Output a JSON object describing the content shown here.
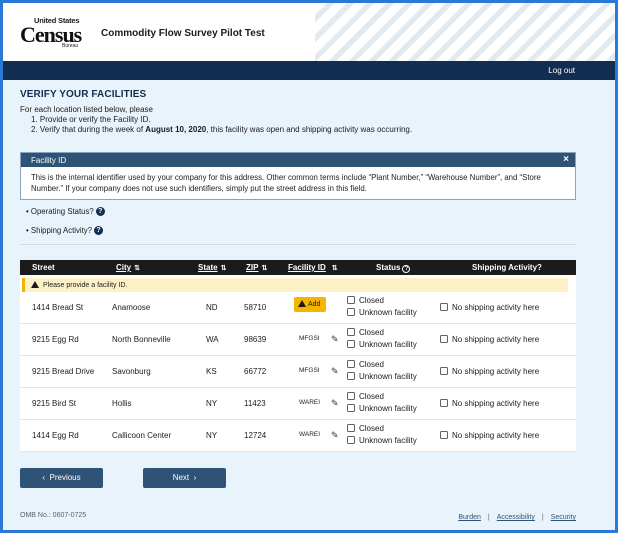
{
  "header": {
    "logo_top": "United States",
    "logo_main": "Census",
    "logo_bottom": "Bureau",
    "app_title": "Commodity Flow Survey Pilot Test",
    "logout": "Log out"
  },
  "page": {
    "title": "VERIFY YOUR FACILITIES",
    "intro": "For each location listed below, please",
    "step1": "1. Provide or verify the Facility ID.",
    "step2_pre": "2. Verify that during the week of ",
    "step2_date": "August 10, 2020",
    "step2_post": ", this facility was open and shipping activity was occurring."
  },
  "facility_id_box": {
    "title": "Facility ID",
    "close": "×",
    "body": "This is the internal identifier used by your company for this address. Other common terms include “Plant Number,” “Warehouse Number”, and “Store Number.” If your company does not use such identifiers, simply put the street address in this field."
  },
  "help": {
    "operating_status": "Operating Status?",
    "shipping_activity": "Shipping Activity?",
    "q": "?"
  },
  "table": {
    "headers": {
      "street": "Street",
      "city": "City",
      "state": "State",
      "zip": "ZIP",
      "facility_id": "Facility ID",
      "status": "Status",
      "shipping": "Shipping Activity?"
    },
    "sort_icon": "⇅",
    "alert": "Please provide a facility ID.",
    "add_label": "Add",
    "closed_label": "Closed",
    "unknown_label": "Unknown facility",
    "noship_label": "No shipping activity here",
    "rows": [
      {
        "street": "1414 Bread St",
        "city": "Anamoose",
        "state": "ND",
        "zip": "58710",
        "facility_id": ""
      },
      {
        "street": "9215 Egg Rd",
        "city": "North Bonneville",
        "state": "WA",
        "zip": "98639",
        "facility_id": "MFGSI"
      },
      {
        "street": "9215 Bread Drive",
        "city": "Savonburg",
        "state": "KS",
        "zip": "66772",
        "facility_id": "MFGSI"
      },
      {
        "street": "9215 Bird St",
        "city": "Hollis",
        "state": "NY",
        "zip": "11423",
        "facility_id": "WAREI"
      },
      {
        "street": "1414 Egg Rd",
        "city": "Callicoon Center",
        "state": "NY",
        "zip": "12724",
        "facility_id": "WAREI"
      }
    ]
  },
  "nav": {
    "previous": "Previous",
    "next": "Next"
  },
  "footer": {
    "omb": "OMB No.: 0607-0725",
    "burden": "Burden",
    "accessibility": "Accessibility",
    "security": "Security",
    "sep": "|"
  }
}
